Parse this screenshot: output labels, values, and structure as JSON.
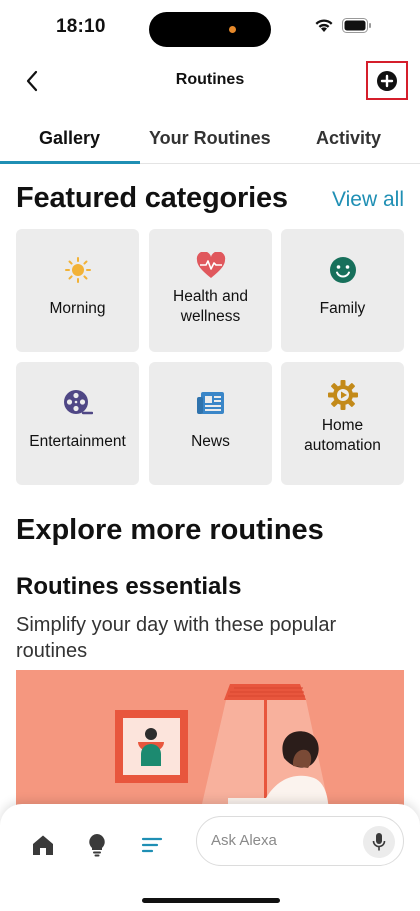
{
  "status_bar": {
    "time": "18:10"
  },
  "header": {
    "title": "Routines"
  },
  "tabs": [
    {
      "label": "Gallery",
      "active": true
    },
    {
      "label": "Your Routines",
      "active": false
    },
    {
      "label": "Activity",
      "active": false
    }
  ],
  "featured": {
    "heading": "Featured categories",
    "view_all": "View all",
    "categories": [
      {
        "label": "Morning",
        "icon": "sun-icon",
        "color": "#f2b237"
      },
      {
        "label": "Health and\nwellness",
        "icon": "heart-pulse-icon",
        "color": "#e0585d"
      },
      {
        "label": "Family",
        "icon": "smiley-icon",
        "color": "#17705b"
      },
      {
        "label": "Entertainment",
        "icon": "film-reel-icon",
        "color": "#4f4785"
      },
      {
        "label": "News",
        "icon": "newspaper-icon",
        "color": "#3a86c8"
      },
      {
        "label": "Home\nautomation",
        "icon": "gear-play-icon",
        "color": "#c38a19"
      }
    ]
  },
  "explore": {
    "title": "Explore more routines",
    "essentials_title": "Routines essentials",
    "essentials_subtitle": "Simplify your day with these popular routines"
  },
  "bottom_nav": {
    "ask_placeholder": "Ask Alexa",
    "items": [
      {
        "icon": "home-icon"
      },
      {
        "icon": "lightbulb-icon"
      },
      {
        "icon": "menu-lines-icon",
        "active": true
      }
    ]
  },
  "colors": {
    "accent": "#1f8fb4",
    "highlight_border": "#d51e2b",
    "tile_bg": "#ececec",
    "banner_bg": "#f5977f"
  }
}
